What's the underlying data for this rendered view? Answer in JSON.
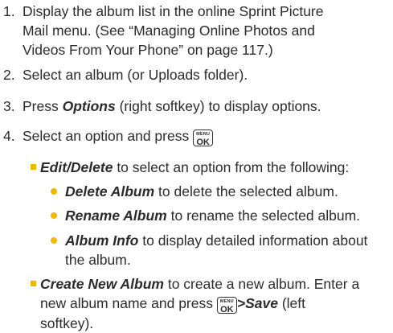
{
  "steps": [
    {
      "num": "1.",
      "lines": [
        "Display the album list in the online Sprint Picture",
        "Mail menu. (See “Managing Online Photos and",
        "Videos From Your Phone” on page 117.)"
      ]
    },
    {
      "num": "2.",
      "text": "Select an album (or Uploads folder)."
    },
    {
      "num": "3.",
      "pre": "Press ",
      "em": "Options",
      "post": " (right softkey) to display options."
    },
    {
      "num": "4.",
      "text": "Select an option and press "
    }
  ],
  "key": {
    "top": "MENU",
    "bottom": "OK"
  },
  "options": {
    "edit": {
      "em": "Edit/Delete",
      "text": " to select an option from the following:"
    },
    "sub": [
      {
        "em": "Delete Album",
        "text": " to delete the selected album."
      },
      {
        "em": "Rename Album",
        "text": " to rename the selected album."
      },
      {
        "em": "Album Info",
        "text": " to display detailed information about",
        "line2": "the album."
      }
    ],
    "create": {
      "em": "Create New Album",
      "line1": " to create a new album. Enter a",
      "line2_pre": "new album name and press ",
      "line2_em": "Save",
      "line2_post": " (left",
      "line3": "softkey)."
    }
  },
  "colors": {
    "bullet": "#f0b800",
    "text": "#2b2b2b"
  }
}
